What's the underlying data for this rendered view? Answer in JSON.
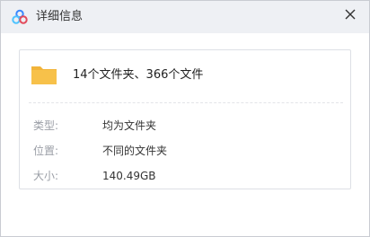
{
  "window": {
    "title": "详细信息"
  },
  "summary": {
    "headline": "14个文件夹、366个文件"
  },
  "details": [
    {
      "label": "类型:",
      "value": "均为文件夹"
    },
    {
      "label": "位置:",
      "value": "不同的文件夹"
    },
    {
      "label": "大小:",
      "value": "140.49GB"
    }
  ],
  "icons": {
    "app": "cloud-logo-icon",
    "close": "close-icon",
    "folder": "folder-icon"
  },
  "colors": {
    "titlebar": "#eef0f4",
    "folder": "#f7c14a",
    "label": "#9a9ea6"
  }
}
